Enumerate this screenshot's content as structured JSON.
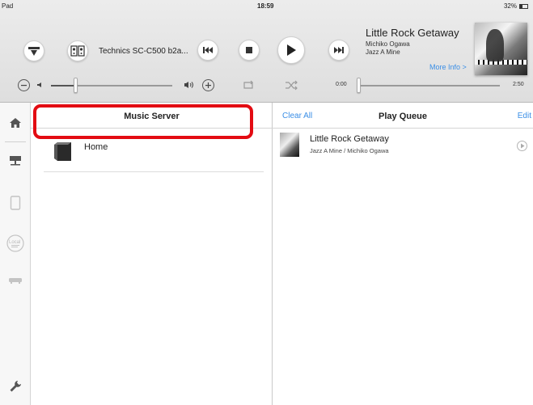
{
  "status_bar": {
    "device": "Pad",
    "time": "18:59",
    "battery": "32%"
  },
  "player": {
    "device_name": "Technics SC-C500 b2a...",
    "time_elapsed": "0:00",
    "time_total": "2:50",
    "volume_level_fraction": 0.2,
    "seek_fraction": 0.0
  },
  "now_playing": {
    "title": "Little Rock Getaway",
    "artist": "Michiko Ogawa",
    "album": "Jazz A Mine",
    "more_info": "More Info >"
  },
  "server_panel": {
    "title": "Music Server",
    "items": [
      {
        "label": "Home",
        "icon": "server-icon"
      }
    ],
    "highlight_color": "#e30b12"
  },
  "queue_panel": {
    "clear_all": "Clear All",
    "title": "Play Queue",
    "edit": "Edit",
    "items": [
      {
        "title": "Little Rock Getaway",
        "subtitle": "Jazz A Mine / Michiko Ogawa"
      }
    ]
  },
  "sidebar": {
    "local_label": "Local"
  },
  "colors": {
    "accent": "#3a8ee6",
    "highlight": "#e30b12"
  }
}
